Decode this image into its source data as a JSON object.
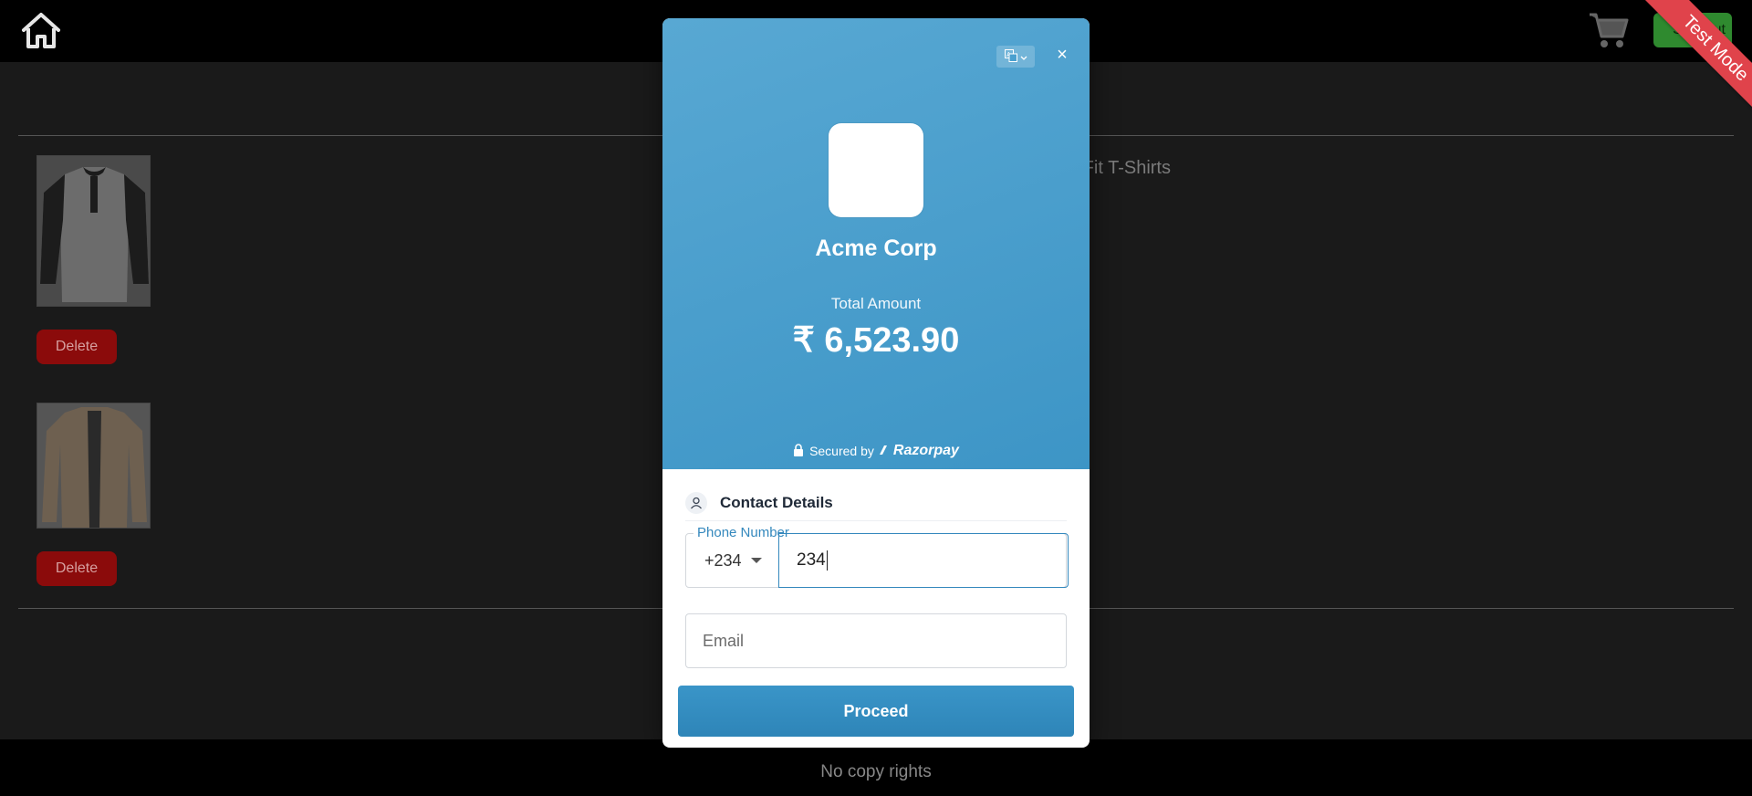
{
  "page": {
    "signout_label": "SignOut",
    "test_mode_label": "Test Mode",
    "product_title_fragment": "n Fit T-Shirts",
    "delete_label": "Delete",
    "footer_text": "No copy rights",
    "icons": [
      "home-icon",
      "cart-icon"
    ]
  },
  "modal": {
    "merchant_name": "Acme Corp",
    "amount_label": "Total Amount",
    "amount_value": "₹ 6,523.90",
    "secured_label": "Secured by",
    "brand_name": "Razorpay",
    "close_symbol": "×",
    "contact_title": "Contact Details",
    "phone": {
      "label": "Phone Number",
      "country_code": "+234",
      "value": "234"
    },
    "email": {
      "placeholder": "Email"
    },
    "proceed_label": "Proceed"
  },
  "colors": {
    "header_blue": "#4aa0cf",
    "accent": "#3488bd",
    "test_ribbon": "#e0434b",
    "delete_red": "#8b0b0b",
    "signout_green": "#2f8a2f"
  }
}
